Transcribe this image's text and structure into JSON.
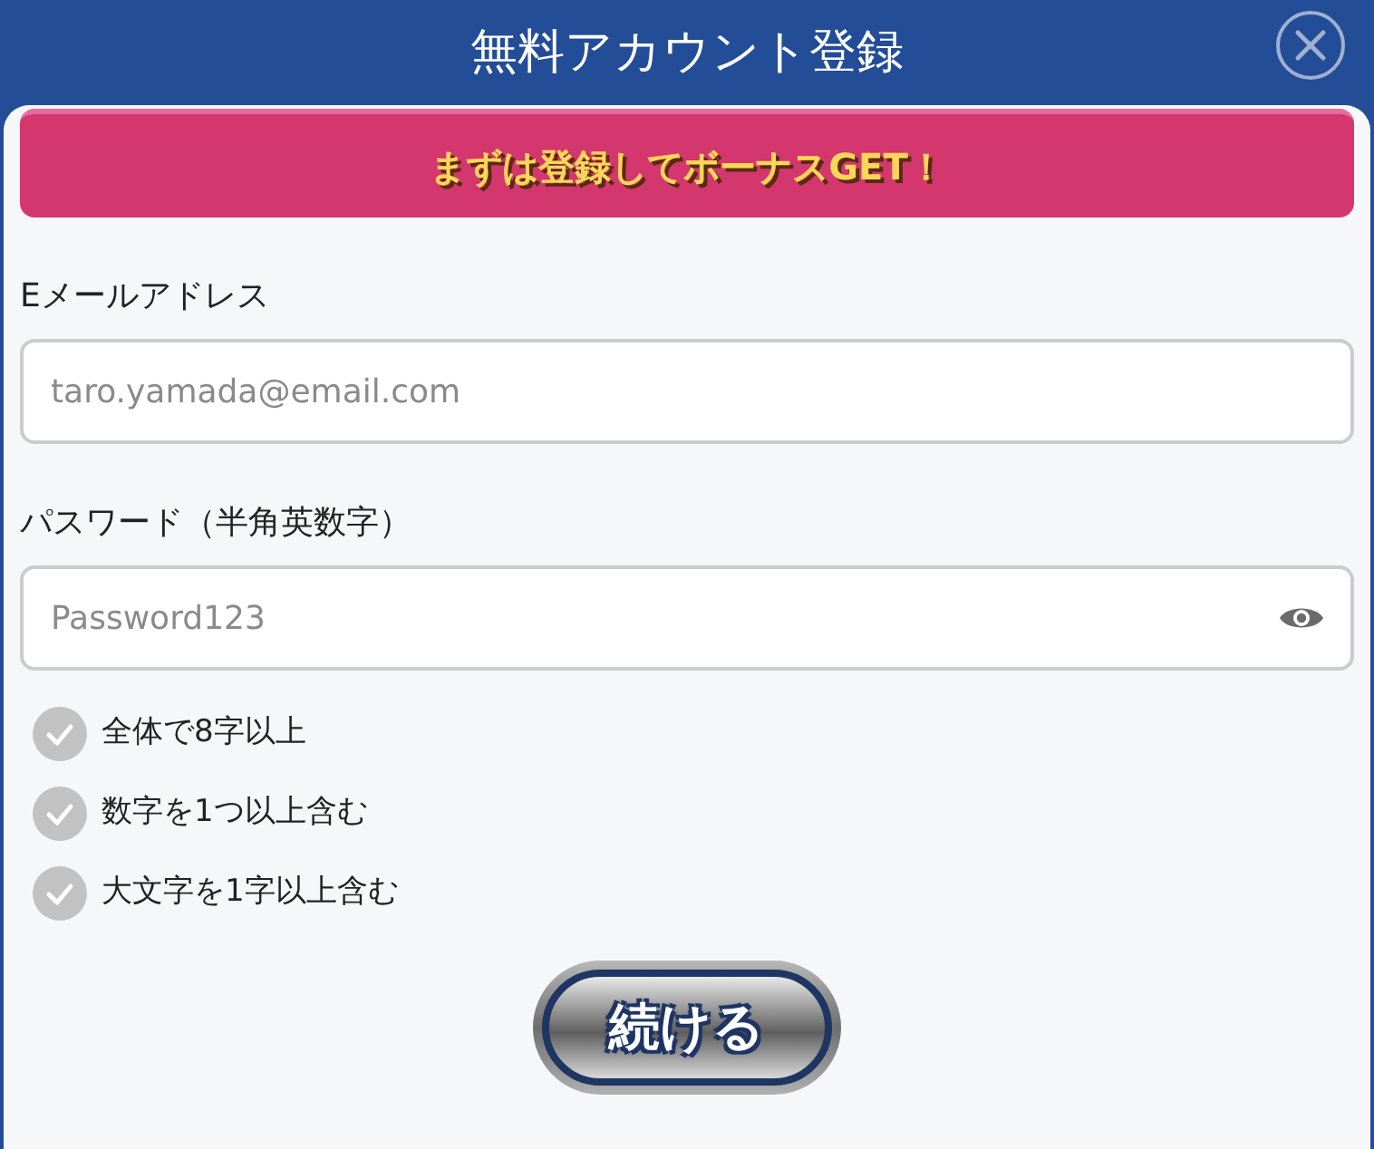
{
  "window": {
    "title": "無料アカウント登録"
  },
  "banner": {
    "text": "まずは登録してボーナスGET！"
  },
  "fields": [
    {
      "kind": "email",
      "label": "Eメールアドレス",
      "placeholder": "taro.yamada@email.com"
    },
    {
      "kind": "password",
      "label": "パスワード（半角英数字）",
      "placeholder": "Password123"
    }
  ],
  "rules": [
    {
      "text": "全体で8字以上",
      "checked": false
    },
    {
      "text": "数字を1つ以上含む",
      "checked": false
    },
    {
      "text": "大文字を1字以上含む",
      "checked": false
    }
  ],
  "submit": {
    "label": "続ける"
  }
}
